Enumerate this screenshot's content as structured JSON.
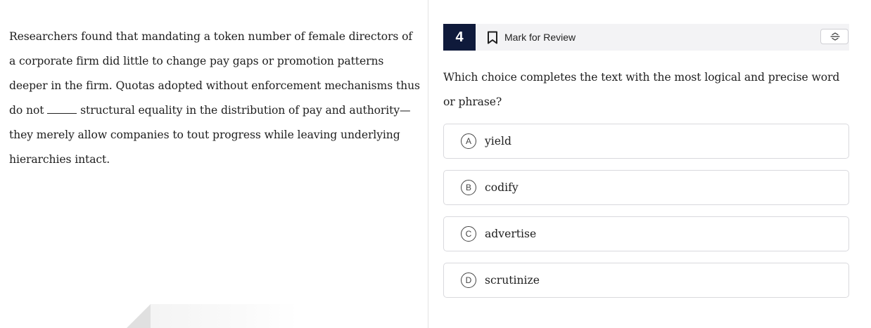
{
  "passage": {
    "text_before_blank": "Researchers found that mandating a token number of female directors of a corporate firm did little to change pay gaps or promotion patterns deeper in the firm. Quotas adopted without enforcement mechanisms thus do not ",
    "text_after_blank": " structural equality in the distribution of pay and authority—they merely allow companies to tout progress while leaving underlying hierarchies intact."
  },
  "question_header": {
    "number": "4",
    "mark_for_review_label": "Mark for Review",
    "icons": {
      "bookmark": "bookmark-icon",
      "strikethrough": "strikethrough-abc-icon"
    }
  },
  "question": {
    "prompt": "Which choice completes the text with the most logical and precise word or phrase?"
  },
  "choices": [
    {
      "letter": "A",
      "text": "yield"
    },
    {
      "letter": "B",
      "text": "codify"
    },
    {
      "letter": "C",
      "text": "advertise"
    },
    {
      "letter": "D",
      "text": "scrutinize"
    }
  ],
  "colors": {
    "number_badge_bg": "#0f1a3b",
    "header_bg": "#f3f3f5",
    "choice_border": "#d9d9dd",
    "pane_divider": "#e3e3e3"
  }
}
